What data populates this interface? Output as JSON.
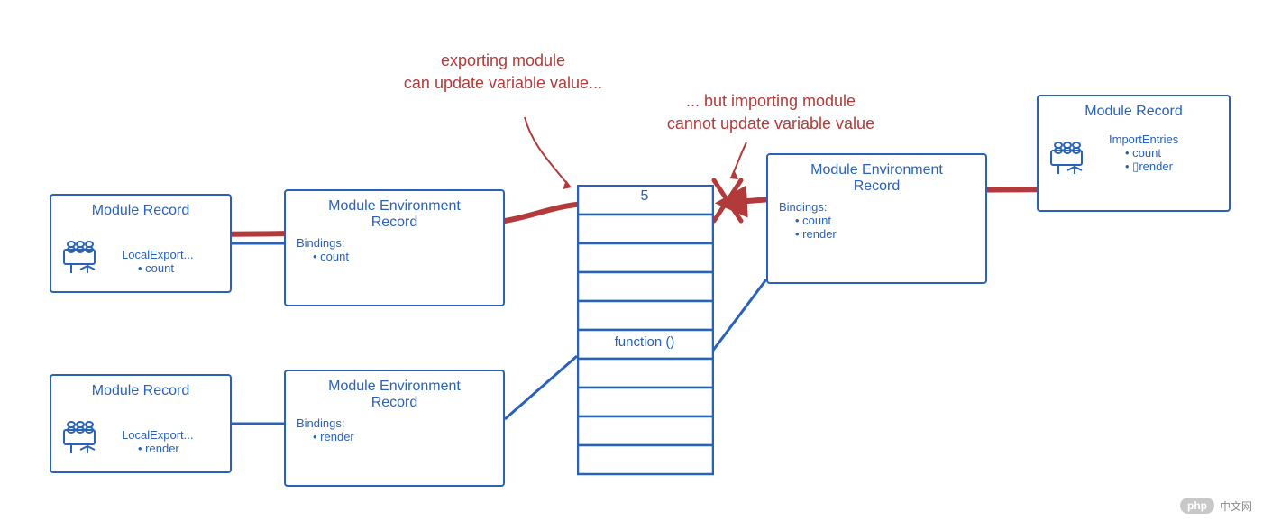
{
  "annotations": {
    "exporting": "exporting module\ncan update variable value...",
    "importing": "... but importing module\ncannot update variable value"
  },
  "boxes": {
    "moduleRecord1": {
      "title": "Module Record",
      "subLabel": "LocalExport...",
      "items": [
        "count"
      ]
    },
    "moduleRecord2": {
      "title": "Module Record",
      "subLabel": "LocalExport...",
      "items": [
        "render"
      ]
    },
    "envRecord1": {
      "title": "Module Environment\nRecord",
      "bindingsLabel": "Bindings:",
      "items": [
        "count"
      ]
    },
    "envRecord2": {
      "title": "Module Environment\nRecord",
      "bindingsLabel": "Bindings:",
      "items": [
        "render"
      ]
    },
    "envRecord3": {
      "title": "Module Environment\nRecord",
      "bindingsLabel": "Bindings:",
      "items": [
        "count",
        "render"
      ]
    },
    "moduleRecord3": {
      "title": "Module Record",
      "importLabel": "ImportEntries",
      "items": [
        "count",
        "▯render"
      ]
    }
  },
  "memory": {
    "cell0": "5",
    "cell5": "function ()"
  },
  "watermark": {
    "badge": "php",
    "text": "中文网"
  },
  "chart_data": {
    "type": "diagram",
    "title": "ES Module binding diagram",
    "nodes": [
      {
        "id": "mr1",
        "label": "Module Record",
        "details": "LocalExport... count"
      },
      {
        "id": "mr2",
        "label": "Module Record",
        "details": "LocalExport... render"
      },
      {
        "id": "env1",
        "label": "Module Environment Record",
        "details": "Bindings: count"
      },
      {
        "id": "env2",
        "label": "Module Environment Record",
        "details": "Bindings: render"
      },
      {
        "id": "mem",
        "label": "Memory cells",
        "details": "cell[0]=5, cell[5]=function ()"
      },
      {
        "id": "env3",
        "label": "Module Environment Record",
        "details": "Bindings: count, render"
      },
      {
        "id": "mr3",
        "label": "Module Record",
        "details": "ImportEntries: count, render"
      }
    ],
    "edges": [
      {
        "from": "mr1",
        "to": "env1",
        "color": "red",
        "note": "exporting module can update variable value"
      },
      {
        "from": "env1",
        "to": "mem.cell0",
        "color": "red",
        "arrow": true
      },
      {
        "from": "mr3",
        "to": "env3",
        "color": "red"
      },
      {
        "from": "env3",
        "to": "mem.cell0",
        "color": "red",
        "blocked": true,
        "note": "importing module cannot update variable value"
      },
      {
        "from": "mr2",
        "to": "env2",
        "color": "blue"
      },
      {
        "from": "env2",
        "to": "mem.cell5",
        "color": "blue"
      },
      {
        "from": "env3",
        "to": "mem.cell5",
        "color": "blue"
      }
    ]
  }
}
